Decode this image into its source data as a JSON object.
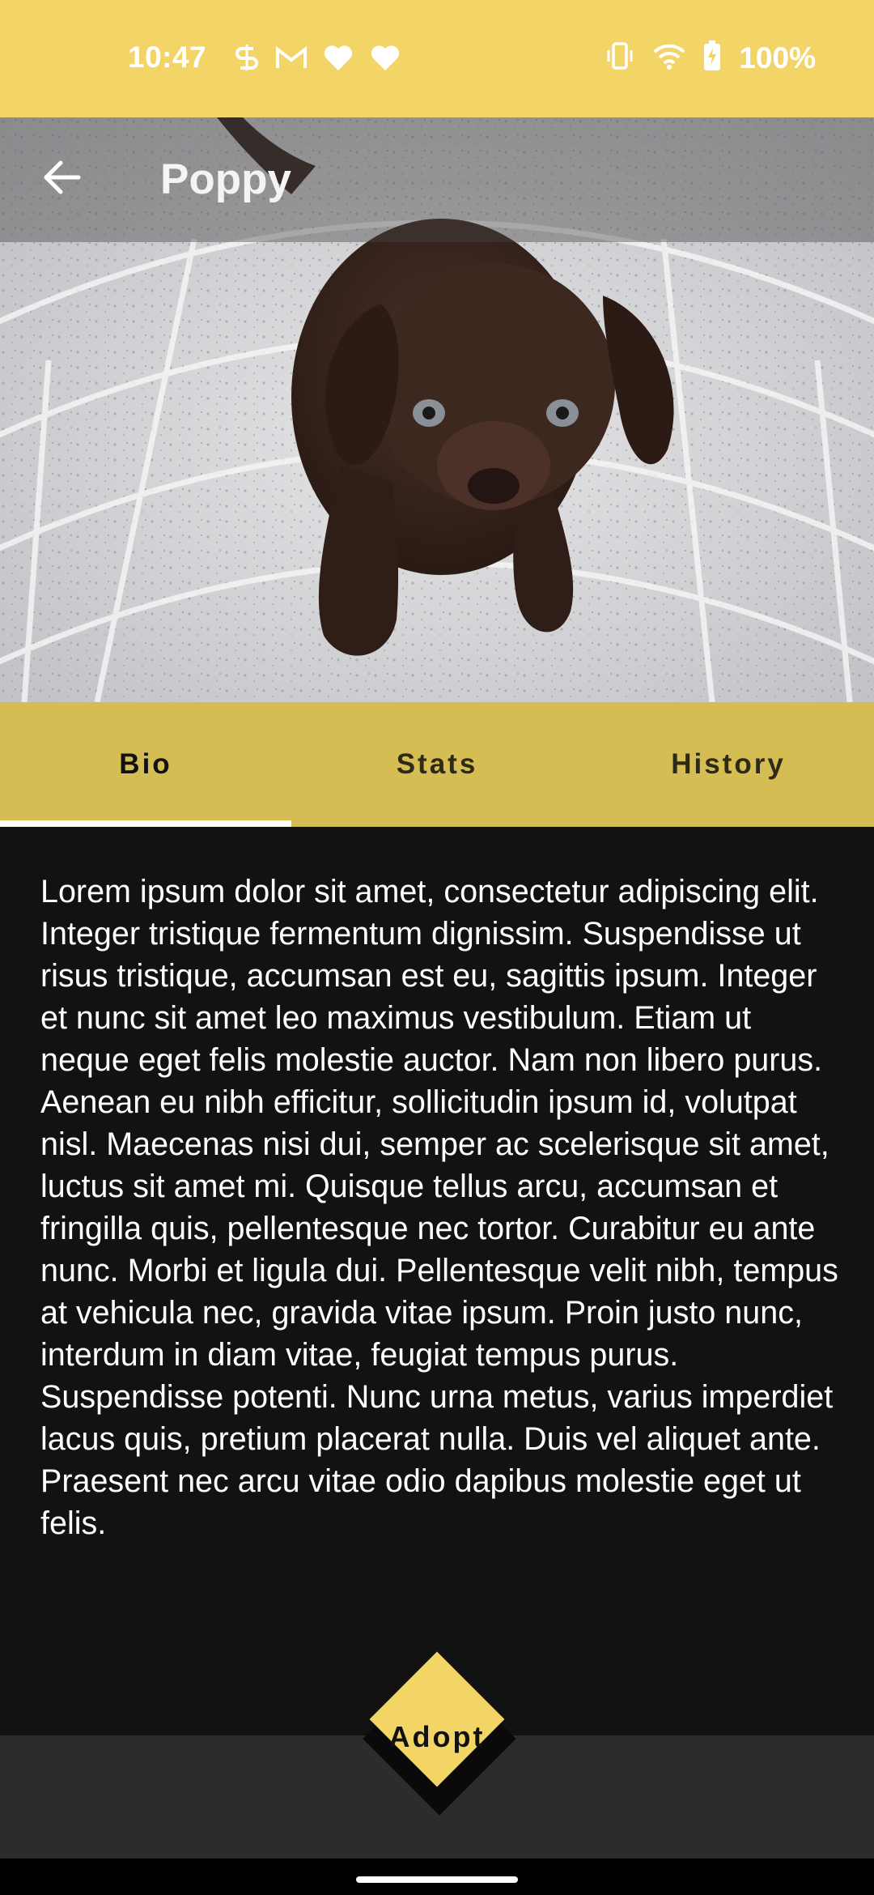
{
  "status_bar": {
    "time": "10:47",
    "battery": "100%",
    "background": "#f3d567",
    "notification_icons": [
      "s-icon",
      "gmail-icon",
      "heart-icon",
      "heart-icon"
    ],
    "system_icons": [
      "vibrate-icon",
      "wifi-icon",
      "battery-charging-icon"
    ]
  },
  "app_bar": {
    "title": "Poppy",
    "back_icon": "arrow-left-icon"
  },
  "hero_image": {
    "subject": "chocolate labrador puppy"
  },
  "tabs": [
    {
      "label": "Bio",
      "active": true
    },
    {
      "label": "Stats",
      "active": false
    },
    {
      "label": "History",
      "active": false
    }
  ],
  "bio": {
    "text": "Lorem ipsum dolor sit amet, consectetur adipiscing elit. Integer tristique fermentum dignissim. Suspendisse ut risus tristique, accumsan est eu, sagittis ipsum. Integer et nunc sit amet leo maximus vestibulum. Etiam ut neque eget felis molestie auctor. Nam non libero purus. Aenean eu nibh efficitur, sollicitudin ipsum id, volutpat nisl. Maecenas nisi dui, semper ac scelerisque sit amet, luctus sit amet mi. Quisque tellus arcu, accumsan et fringilla quis, pellentesque nec tortor. Curabitur eu ante nunc. Morbi et ligula dui. Pellentesque velit nibh, tempus at vehicula nec, gravida vitae ipsum. Proin justo nunc, interdum in diam vitae, feugiat tempus purus. Suspendisse potenti. Nunc urna metus, varius imperdiet lacus quis, pretium placerat nulla. Duis vel aliquet ante. Praesent nec arcu vitae odio dapibus molestie eget ut felis."
  },
  "action": {
    "adopt_label": "Adopt"
  },
  "colors": {
    "accent": "#f3d567",
    "tab_bar": "#d6bd53",
    "background": "#121212",
    "bottom_bar": "#2c2c2c"
  }
}
